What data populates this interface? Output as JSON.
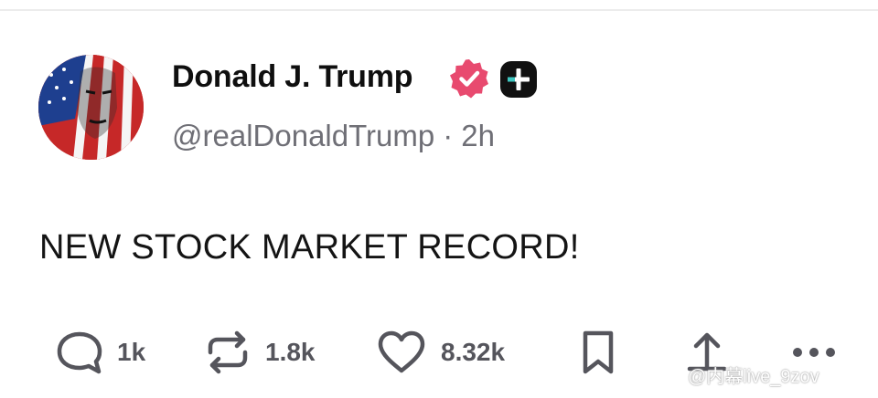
{
  "post": {
    "author_name": "Donald J. Trump",
    "handle": "@realDonaldTrump",
    "separator": "·",
    "time_ago": "2h",
    "text": "NEW STOCK MARKET RECORD!",
    "verified_badge_color": "#e84a6f"
  },
  "actions": {
    "reply_count": "1k",
    "repost_count": "1.8k",
    "like_count": "8.32k"
  },
  "icons": [
    "verified-badge-icon",
    "plus-badge-icon",
    "reply-icon",
    "repost-icon",
    "like-icon",
    "bookmark-icon",
    "share-icon",
    "more-icon"
  ],
  "watermark": {
    "text": "@内幕live_9zov"
  },
  "colors": {
    "text": "#111111",
    "muted": "#6f6f76",
    "action": "#55555c"
  }
}
